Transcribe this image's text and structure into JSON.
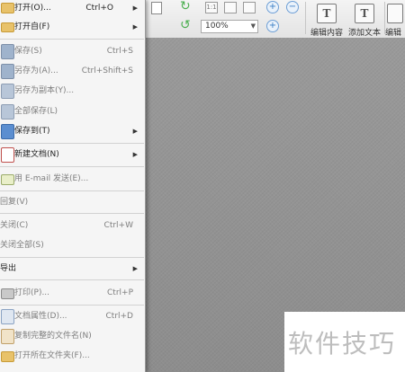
{
  "toolbar": {
    "zoom_value": "100%",
    "edit_content_label": "编辑内容",
    "add_text_label": "添加文本",
    "edit_more_label": "编辑"
  },
  "menu": {
    "items": [
      {
        "label": "打开(O)...",
        "shortcut": "Ctrl+O",
        "submenu": true
      },
      {
        "label": "打开自(F)",
        "shortcut": "",
        "submenu": true
      },
      {
        "label": "保存(S)",
        "shortcut": "Ctrl+S",
        "submenu": false
      },
      {
        "label": "另存为(A)...",
        "shortcut": "Ctrl+Shift+S",
        "submenu": false
      },
      {
        "label": "另存为副本(Y)...",
        "shortcut": "",
        "submenu": false
      },
      {
        "label": "全部保存(L)",
        "shortcut": "",
        "submenu": false
      },
      {
        "label": "保存到(T)",
        "shortcut": "",
        "submenu": true
      },
      {
        "label": "新建文档(N)",
        "shortcut": "",
        "submenu": true
      },
      {
        "label": "用 E-mail 发送(E)...",
        "shortcut": "",
        "submenu": false
      },
      {
        "label": "回复(V)",
        "shortcut": "",
        "submenu": false
      },
      {
        "label": "关闭(C)",
        "shortcut": "Ctrl+W",
        "submenu": false
      },
      {
        "label": "关闭全部(S)",
        "shortcut": "",
        "submenu": false
      },
      {
        "label": "导出",
        "shortcut": "",
        "submenu": true
      },
      {
        "label": "打印(P)...",
        "shortcut": "Ctrl+P",
        "submenu": false
      },
      {
        "label": "文档属性(D)...",
        "shortcut": "Ctrl+D",
        "submenu": false
      },
      {
        "label": "复制完整的文件名(N)",
        "shortcut": "",
        "submenu": false
      },
      {
        "label": "打开所在文件夹(F)...",
        "shortcut": "",
        "submenu": false
      }
    ]
  },
  "watermark": "软件技巧",
  "colors": {
    "canvas": "#9a9a9a",
    "menu_bg": "#f5f5f5",
    "disabled_text": "#7e7e7e",
    "accent_green": "#4caf50",
    "accent_blue": "#3a7dc4"
  }
}
